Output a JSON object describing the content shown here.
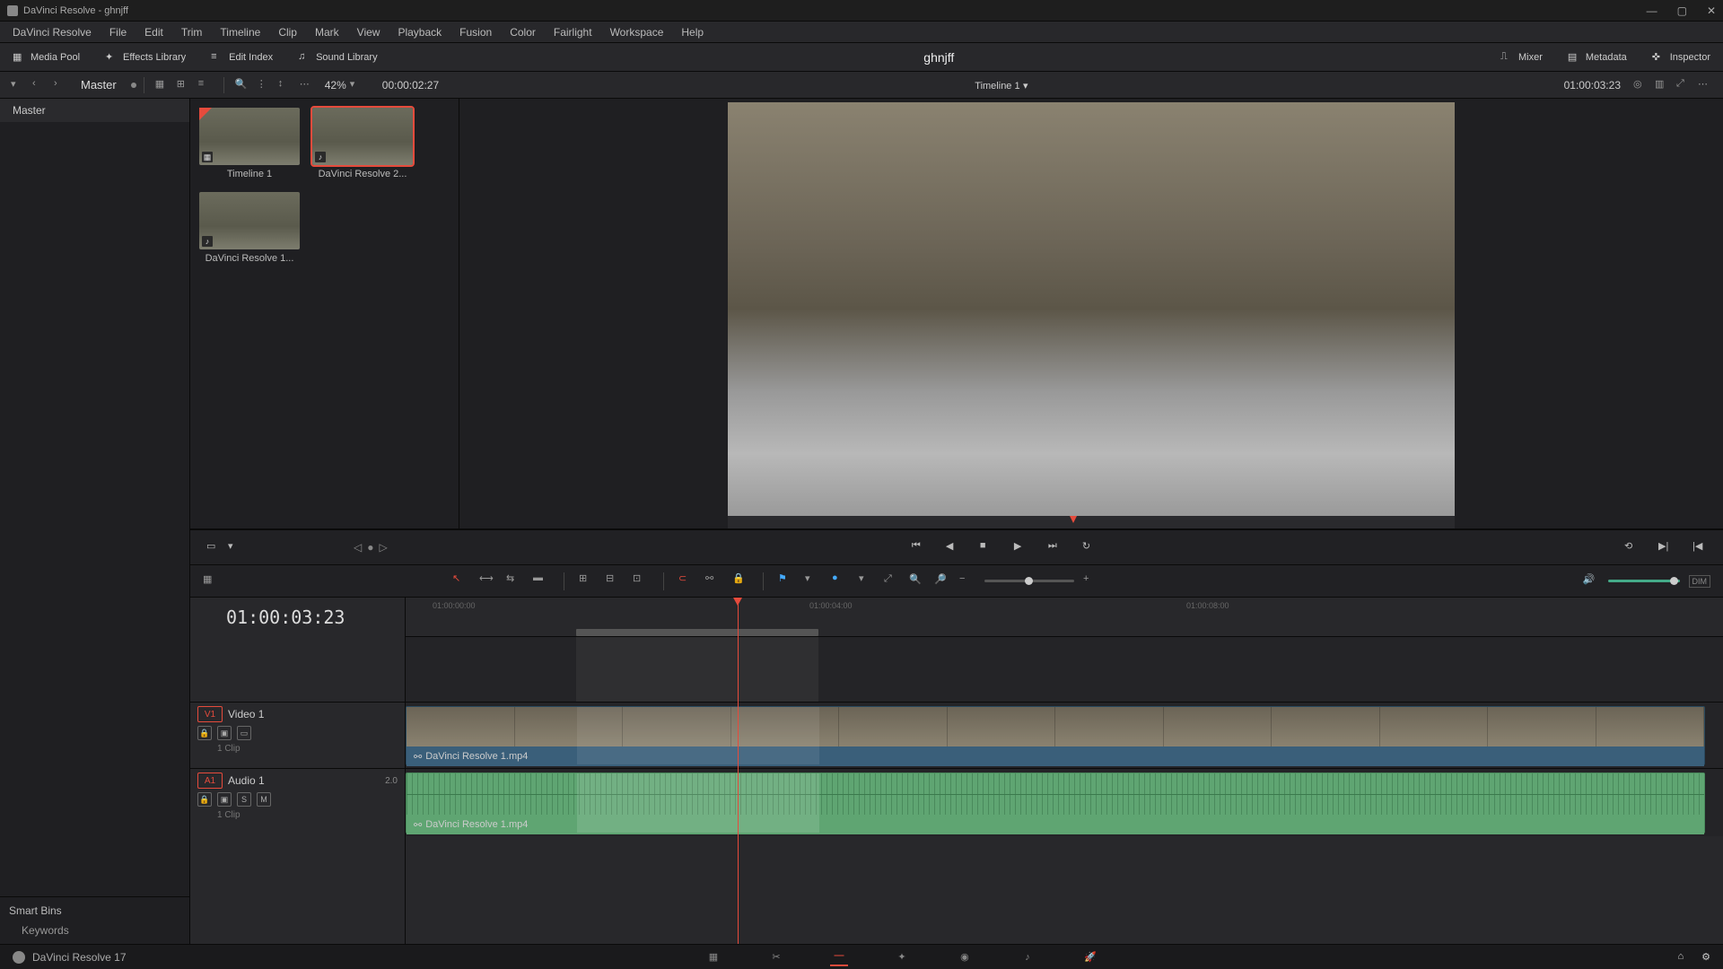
{
  "titlebar": {
    "title": "DaVinci Resolve - ghnjff"
  },
  "menubar": [
    "DaVinci Resolve",
    "File",
    "Edit",
    "Trim",
    "Timeline",
    "Clip",
    "Mark",
    "View",
    "Playback",
    "Fusion",
    "Color",
    "Fairlight",
    "Workspace",
    "Help"
  ],
  "toolbar": {
    "mediaPool": "Media Pool",
    "effectsLibrary": "Effects Library",
    "editIndex": "Edit Index",
    "soundLibrary": "Sound Library",
    "projectName": "ghnjff",
    "mixer": "Mixer",
    "metadata": "Metadata",
    "inspector": "Inspector"
  },
  "secondaryBar": {
    "master": "Master",
    "zoom": "42%",
    "sourceTimecode": "00:00:02:27",
    "timelineName": "Timeline 1",
    "timelineTimecode": "01:00:03:23"
  },
  "sidebar": {
    "bin": "Master",
    "smartBins": "Smart Bins",
    "keywords": "Keywords"
  },
  "clips": [
    {
      "name": "Timeline 1",
      "badge": "▦"
    },
    {
      "name": "DaVinci Resolve 2...",
      "badge": "♪"
    },
    {
      "name": "DaVinci Resolve 1...",
      "badge": "♪"
    }
  ],
  "timeline": {
    "timecode": "01:00:03:23",
    "video": {
      "tag": "V1",
      "name": "Video 1",
      "clipCount": "1 Clip"
    },
    "audio": {
      "tag": "A1",
      "name": "Audio 1",
      "level": "2.0",
      "clipCount": "1 Clip"
    },
    "clipLabel": "DaVinci Resolve 1.mp4",
    "ticks": [
      "01:00:00:00",
      "01:00:04:00",
      "01:00:08:00"
    ]
  },
  "editToolbar": {
    "dim": "DIM"
  },
  "bottombar": {
    "app": "DaVinci Resolve 17"
  }
}
